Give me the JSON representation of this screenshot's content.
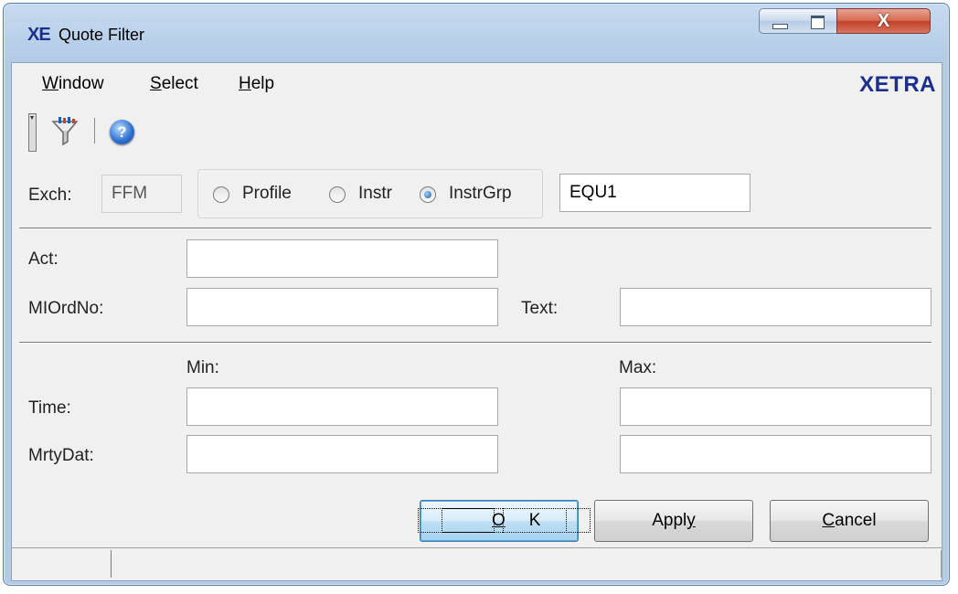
{
  "window": {
    "logo": "XE",
    "title": "Quote Filter",
    "close_glyph": "X"
  },
  "menu": {
    "items": [
      {
        "pre": "",
        "u": "W",
        "post": "indow"
      },
      {
        "pre": "",
        "u": "S",
        "post": "elect"
      },
      {
        "pre": "",
        "u": "H",
        "post": "elp"
      }
    ],
    "brand": "XETRA"
  },
  "toolbar": {
    "icons": [
      "toolbar-grip",
      "filter-icon",
      "help-icon"
    ],
    "help_glyph": "?"
  },
  "filter": {
    "exch_label": "Exch:",
    "exch_value": "FFM",
    "radio_options": [
      {
        "label": "Profile",
        "checked": false
      },
      {
        "label": "Instr",
        "checked": false
      },
      {
        "label": "InstrGrp",
        "checked": true
      }
    ],
    "group_value": "EQU1"
  },
  "fields": {
    "act_label": "Act:",
    "act_value": "",
    "mlordno_label": "MIOrdNo:",
    "mlordno_value": "",
    "text_label": "Text:",
    "text_value": ""
  },
  "range": {
    "min_label": "Min:",
    "max_label": "Max:",
    "time_label": "Time:",
    "time_min": "",
    "time_max": "",
    "mrtydat_label": "MrtyDat:",
    "mrtydat_min": "",
    "mrtydat_max": ""
  },
  "buttons": {
    "ok": {
      "pre": "",
      "u": "O",
      "post": "K"
    },
    "apply": {
      "pre": "Appl",
      "u": "y",
      "post": ""
    },
    "cancel": {
      "pre": "",
      "u": "C",
      "post": "ancel"
    }
  },
  "status": {
    "cells": [
      "",
      ""
    ]
  },
  "colors": {
    "brand": "#1c2f8c",
    "client_bg": "#f0f0f0",
    "close_red": "#c2412a"
  }
}
